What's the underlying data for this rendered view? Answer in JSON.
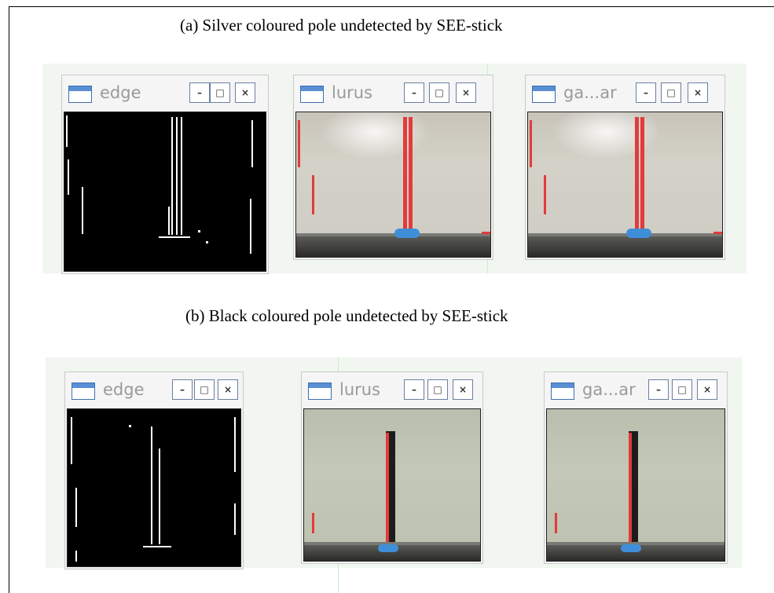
{
  "figure": {
    "caption_a": "(a) Silver coloured pole undetected by SEE-stick",
    "caption_b": "(b) Black coloured pole undetected by SEE-stick"
  },
  "row_a": {
    "windows": [
      {
        "title": "edge",
        "minimize": "–",
        "maximize": "□",
        "close": "×"
      },
      {
        "title": "lurus",
        "minimize": "–",
        "maximize": "□",
        "close": "×"
      },
      {
        "title": "ga...ar",
        "minimize": "–",
        "maximize": "□",
        "close": "×"
      }
    ]
  },
  "row_b": {
    "windows": [
      {
        "title": "edge",
        "minimize": "–",
        "maximize": "□",
        "close": "×"
      },
      {
        "title": "lurus",
        "minimize": "–",
        "maximize": "□",
        "close": "×"
      },
      {
        "title": "ga...ar",
        "minimize": "–",
        "maximize": "□",
        "close": "×"
      }
    ]
  },
  "colors": {
    "detection_line": "#e23b3b",
    "icon_blue": "#3d6fb0",
    "panel_bg": "#f1f6f0"
  }
}
